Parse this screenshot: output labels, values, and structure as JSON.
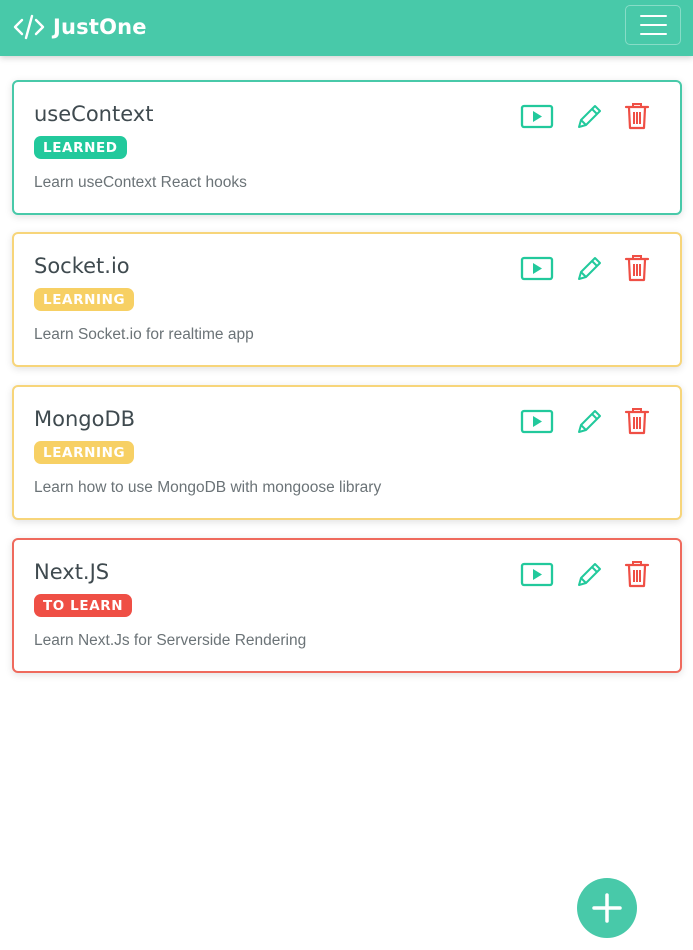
{
  "navbar": {
    "brand": "JustOne",
    "brand_icon": "code-icon",
    "menu_icon": "hamburger-icon",
    "color": "#48c9a9"
  },
  "cards": [
    {
      "title": "useContext",
      "status": "LEARNED",
      "description": "Learn useContext React hooks",
      "status_color": "#22c99c"
    },
    {
      "title": "Socket.io",
      "status": "LEARNING",
      "description": "Learn Socket.io for realtime app",
      "status_color": "#f7d064"
    },
    {
      "title": "MongoDB",
      "status": "LEARNING",
      "description": "Learn how to use MongoDB with mongoose library",
      "status_color": "#f7d064"
    },
    {
      "title": "Next.JS",
      "status": "TO LEARN",
      "description": "Learn Next.Js for Serverside Rendering",
      "status_color": "#ef4f45"
    }
  ],
  "actions": {
    "play_icon": "play-icon",
    "edit_icon": "pencil-icon",
    "delete_icon": "trash-icon"
  },
  "fab": {
    "icon": "plus-icon"
  }
}
